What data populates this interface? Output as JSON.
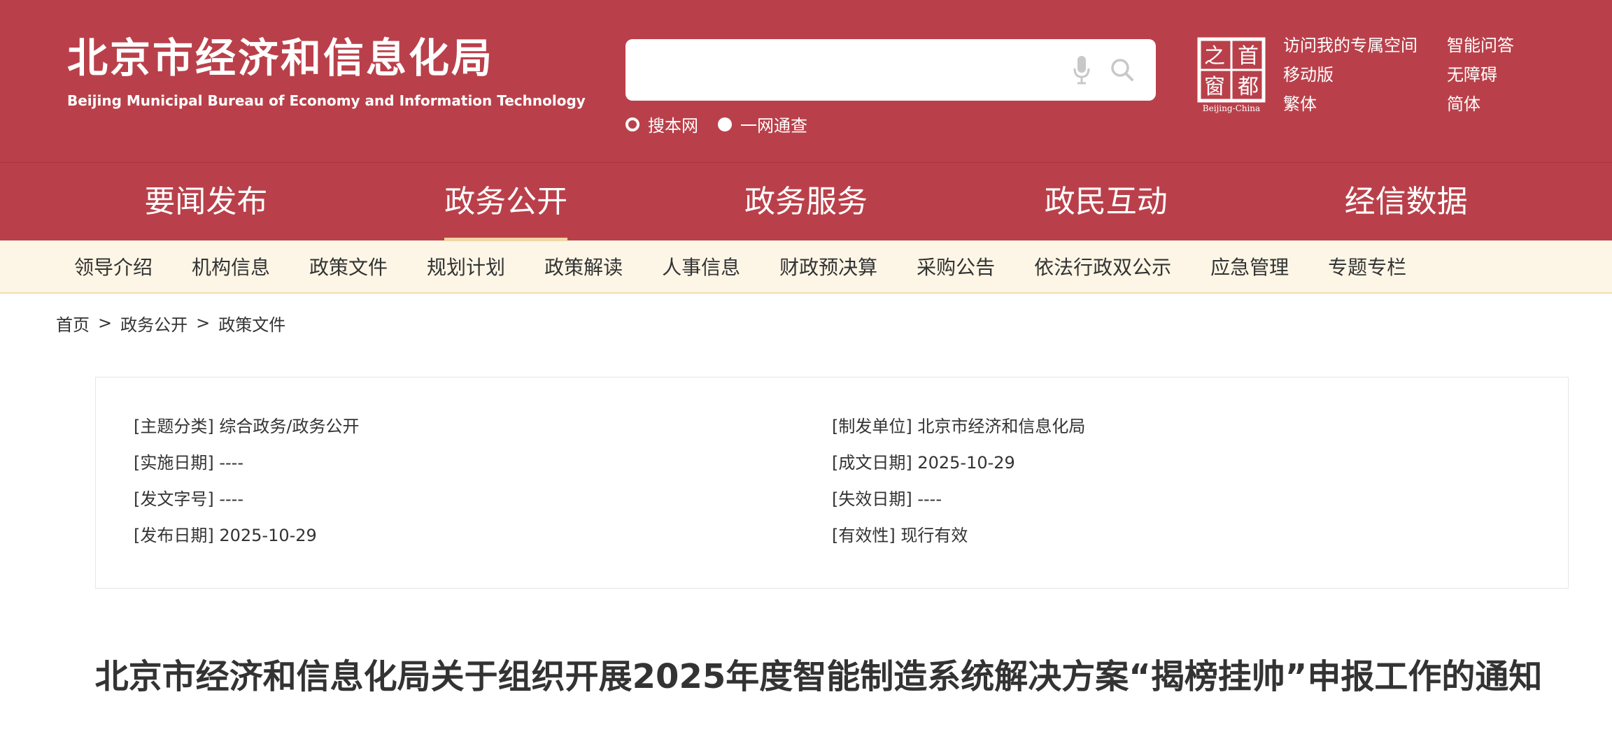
{
  "header": {
    "logo_cn": "北京市经济和信息化局",
    "logo_en": "Beijing Municipal Bureau of Economy and Information Technology",
    "search": {
      "placeholder": "",
      "scopes": [
        "搜本网",
        "一网通查"
      ],
      "selected_scope": "一网通查"
    },
    "seal": {
      "chars": [
        "首",
        "都",
        "之",
        "窗"
      ],
      "caption": "Beijing-China"
    },
    "links": [
      "访问我的专属空间",
      "智能问答",
      "移动版",
      "无障碍",
      "繁体",
      "简体"
    ]
  },
  "main_nav": {
    "items": [
      "要闻发布",
      "政务公开",
      "政务服务",
      "政民互动",
      "经信数据"
    ],
    "active": "政务公开"
  },
  "sub_nav": {
    "items": [
      "领导介绍",
      "机构信息",
      "政策文件",
      "规划计划",
      "政策解读",
      "人事信息",
      "财政预决算",
      "采购公告",
      "依法行政双公示",
      "应急管理",
      "专题专栏"
    ]
  },
  "breadcrumb": [
    "首页",
    "政务公开",
    "政策文件"
  ],
  "meta": {
    "left": [
      "[主题分类] 综合政务/政务公开",
      "[实施日期] ----",
      "[发文字号] ----",
      "[发布日期] 2025-10-29"
    ],
    "right": [
      "[制发单位] 北京市经济和信息化局",
      "[成文日期] 2025-10-29",
      "[失效日期] ----",
      "[有效性] 现行有效"
    ]
  },
  "article": {
    "title": "北京市经济和信息化局关于组织开展2025年度智能制造系统解决方案“揭榜挂帅”申报工作的通知"
  },
  "colors": {
    "brand_red": "#b9404a",
    "subnav_bg": "#fdf6e6",
    "active_underline": "#f2d6a6",
    "text_dark": "#333333"
  }
}
